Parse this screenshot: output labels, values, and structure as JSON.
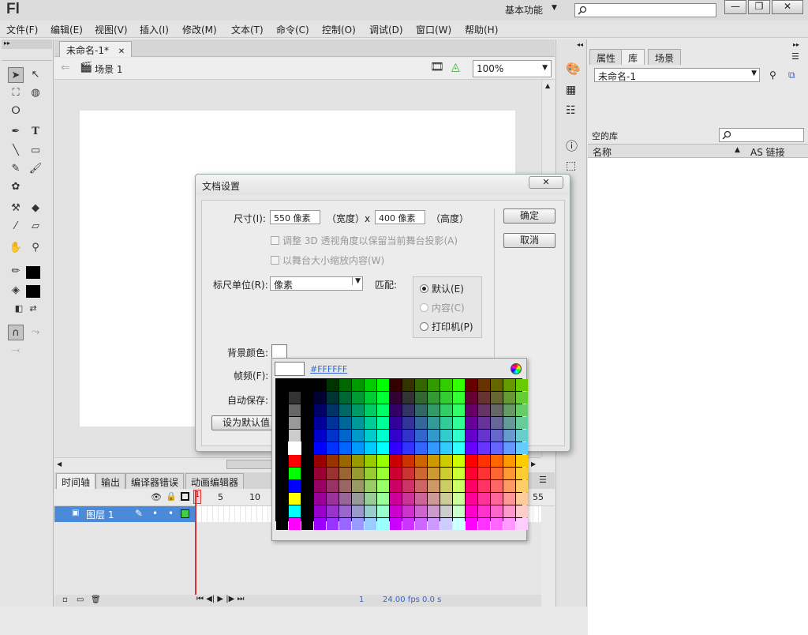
{
  "app": {
    "logo": "Fl",
    "workspace": "基本功能"
  },
  "window_buttons": [
    "—",
    "❐",
    "✕"
  ],
  "menu": [
    "文件(F)",
    "编辑(E)",
    "视图(V)",
    "插入(I)",
    "修改(M)",
    "文本(T)",
    "命令(C)",
    "控制(O)",
    "调试(D)",
    "窗口(W)",
    "帮助(H)"
  ],
  "document": {
    "tab": "未命名-1*",
    "scene": "场景 1",
    "zoom": "100%"
  },
  "timeline": {
    "tabs": [
      "时间轴",
      "输出",
      "编译器错误",
      "动画编辑器"
    ],
    "layer": "图层 1",
    "ruler": [
      "1",
      "5",
      "10",
      "55"
    ],
    "footer": {
      "frame": "1",
      "fps": "24.00 fps",
      "time": "0.0 s"
    }
  },
  "right_panel": {
    "tabs": [
      "属性",
      "库",
      "场景"
    ],
    "library_name": "未命名-1",
    "empty_label": "空的库",
    "col_name": "名称",
    "col_link": "AS 链接"
  },
  "dialog": {
    "title": "文档设置",
    "size_label": "尺寸(I):",
    "width": "550 像素",
    "width_label": "（宽度）x",
    "height": "400 像素",
    "height_label": "（高度）",
    "adjust3d": "调整 3D 透视角度以保留当前舞台投影(A)",
    "scale_content": "以舞台大小缩放内容(W)",
    "ruler_label": "标尺单位(R):",
    "ruler_value": "像素",
    "match_label": "匹配:",
    "match_options": [
      "默认(E)",
      "内容(C)",
      "打印机(P)"
    ],
    "bg_label": "背景颜色:",
    "fps_label": "帧频(F):",
    "autosave_label": "自动保存:",
    "ok": "确定",
    "cancel": "取消",
    "set_default": "设为默认值"
  },
  "color_picker": {
    "hex": "#FFFFFF",
    "selected": "#ffffff"
  }
}
